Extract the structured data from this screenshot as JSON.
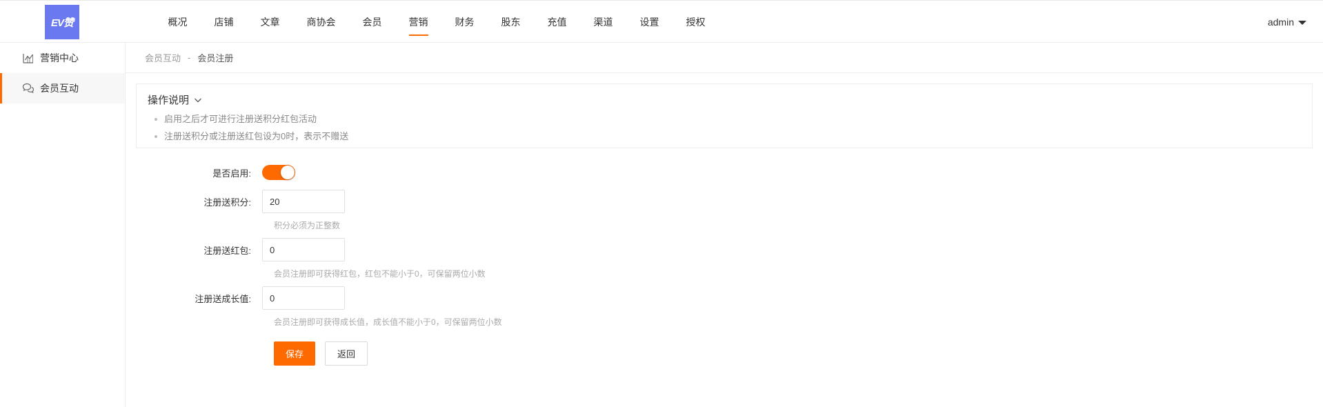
{
  "header": {
    "logo_text": "EV赞",
    "nav": [
      {
        "label": "概况"
      },
      {
        "label": "店铺"
      },
      {
        "label": "文章"
      },
      {
        "label": "商协会"
      },
      {
        "label": "会员"
      },
      {
        "label": "营销",
        "active": true
      },
      {
        "label": "财务"
      },
      {
        "label": "股东"
      },
      {
        "label": "充值"
      },
      {
        "label": "渠道"
      },
      {
        "label": "设置"
      },
      {
        "label": "授权"
      }
    ],
    "user": "admin"
  },
  "sidebar": {
    "items": [
      {
        "label": "营销中心",
        "icon": "chart-line-icon"
      },
      {
        "label": "会员互动",
        "icon": "chat-bubbles-icon",
        "active": true
      }
    ]
  },
  "breadcrumb": {
    "parent": "会员互动",
    "separator": "-",
    "current": "会员注册"
  },
  "tips": {
    "title": "操作说明",
    "items": [
      "启用之后才可进行注册送积分红包活动",
      "注册送积分或注册送红包设为0时，表示不赠送"
    ]
  },
  "form": {
    "enabled": {
      "label": "是否启用:",
      "value": true
    },
    "points": {
      "label": "注册送积分:",
      "value": "20",
      "hint": "积分必须为正整数"
    },
    "redpacket": {
      "label": "注册送红包:",
      "value": "0",
      "hint": "会员注册即可获得红包，红包不能小于0，可保留两位小数"
    },
    "growth": {
      "label": "注册送成长值:",
      "value": "0",
      "hint": "会员注册即可获得成长值，成长值不能小于0，可保留两位小数"
    },
    "save_label": "保存",
    "back_label": "返回"
  },
  "colors": {
    "accent": "#ff6a00",
    "logo_bg": "#6b79f0"
  }
}
